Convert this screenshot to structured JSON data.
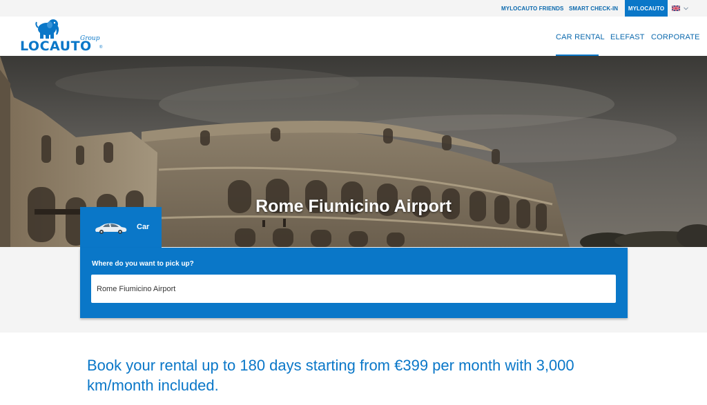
{
  "topbar": {
    "friends_label": "MYLOCAUTO FRIENDS",
    "checkin_label": "SMART CHECK-IN",
    "mylocauto_label": "MYLOCAUTO",
    "language_icon": "uk-flag-icon"
  },
  "logo": {
    "group_text": "Group",
    "brand_text": "LOCAUTO",
    "reg_mark": "®"
  },
  "nav": {
    "items": [
      {
        "label": "CAR RENTAL",
        "active": true
      },
      {
        "label": "ELEFAST"
      },
      {
        "label": "CORPORATE"
      }
    ]
  },
  "hero": {
    "title": "Rome Fiumicino Airport"
  },
  "booking": {
    "tab_label": "Car",
    "question": "Where do you want to pick up?",
    "pickup_value": "Rome Fiumicino Airport"
  },
  "promo": {
    "text": "Book your rental up to 180 days starting from €399 per month with 3,000 km/month included."
  },
  "colors": {
    "brand_blue": "#0a77c8",
    "link_blue": "#0a68ad",
    "band_grey": "#f4f4f4"
  }
}
